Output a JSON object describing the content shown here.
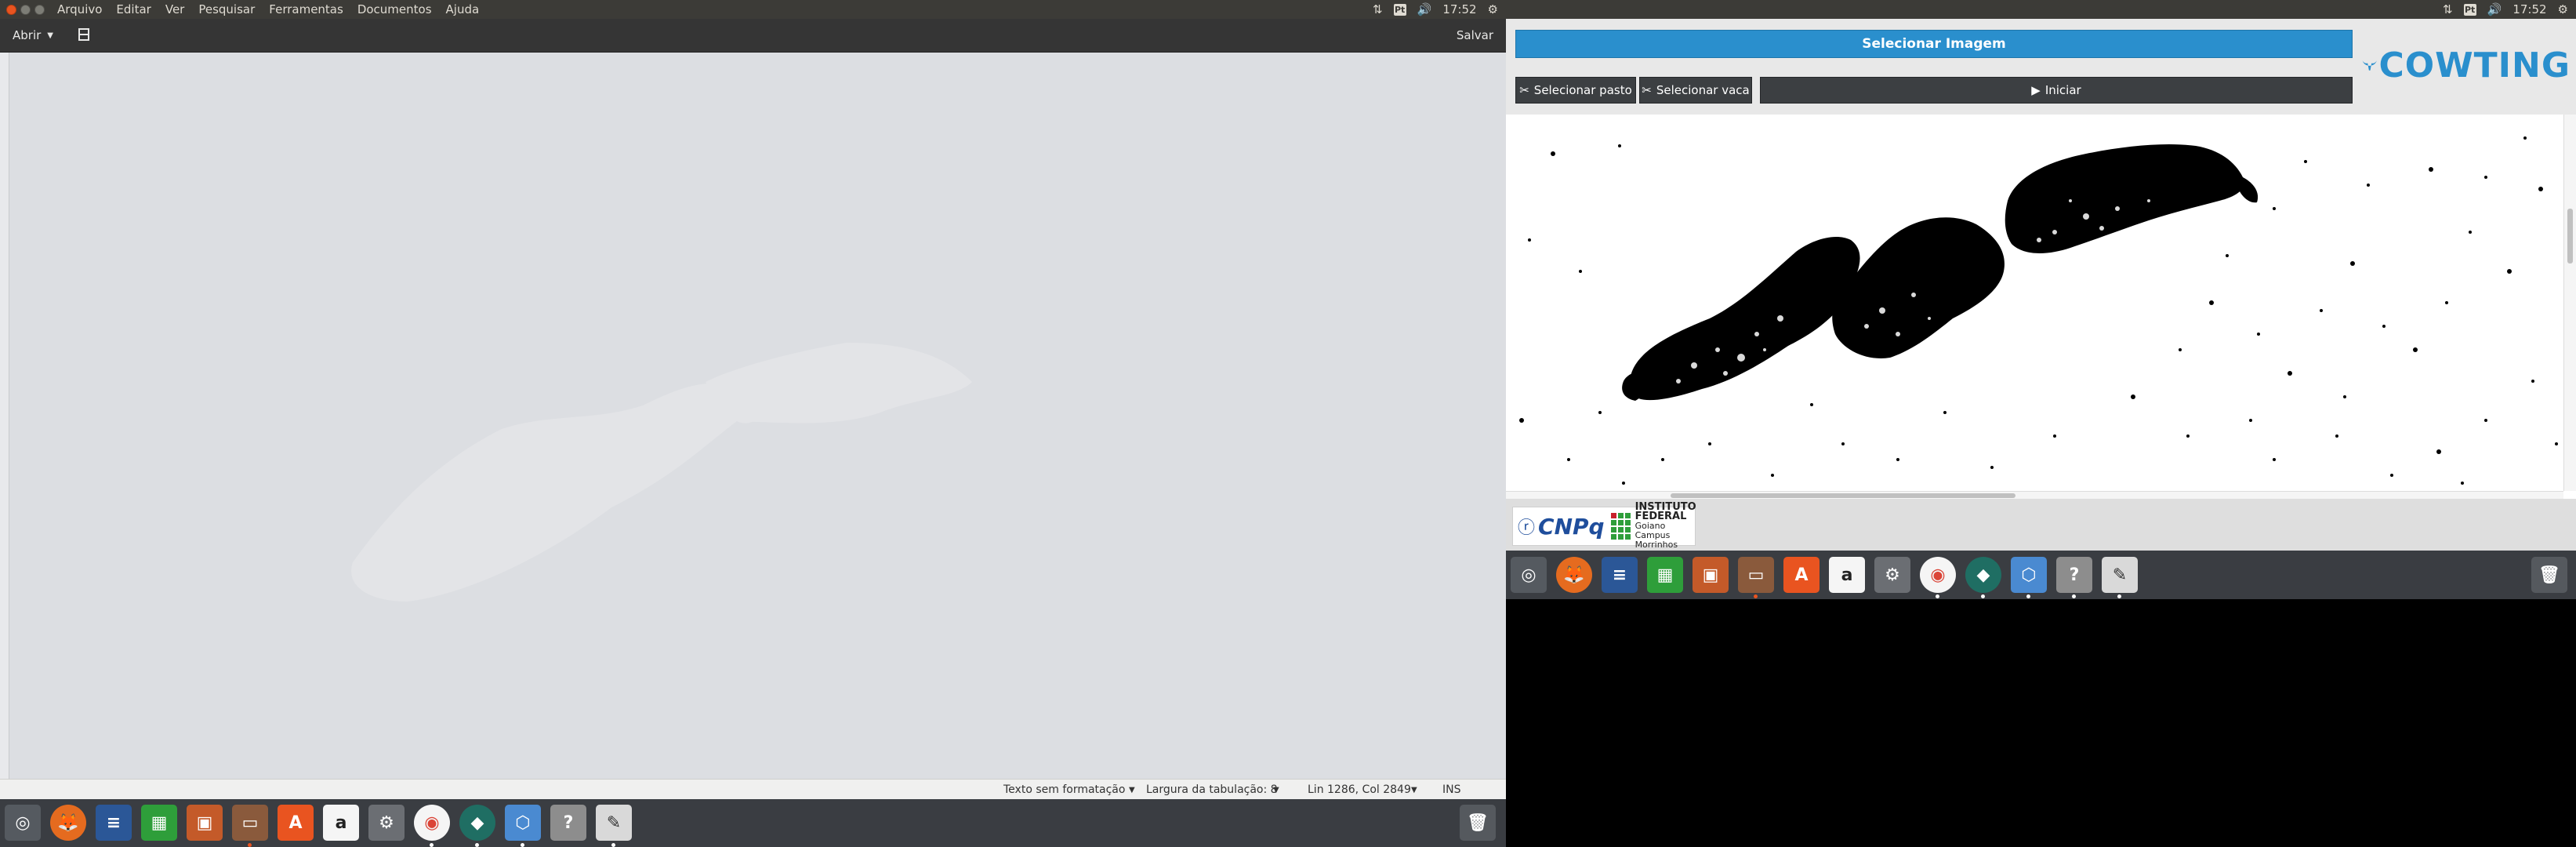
{
  "left_screen": {
    "topbar": {
      "menu": [
        "Arquivo",
        "Editar",
        "Ver",
        "Pesquisar",
        "Ferramentas",
        "Documentos",
        "Ajuda"
      ],
      "clock": "17:52",
      "keyboard": "Pt"
    },
    "gedit": {
      "open_label": "Abrir",
      "save_label": "Salvar"
    },
    "status": {
      "syntax": "Texto sem formatação",
      "tab_width": "Largura da tabulação: 8",
      "position": "Lin 1286, Col 2849",
      "mode": "INS"
    }
  },
  "right_screen": {
    "topbar": {
      "clock": "17:52",
      "keyboard": "Pt"
    },
    "app": {
      "select_image_label": "Selecionar Imagem",
      "select_pasture_label": "Selecionar pasto",
      "select_cow_label": "Selecionar vaca",
      "start_label": "Iniciar",
      "logo_text": "COWTING",
      "cnpq_text": "CNPq",
      "if_title": "INSTITUTO FEDERAL",
      "if_line2": "Goiano",
      "if_line3": "Campus Morrinhos"
    }
  },
  "dock_icons": [
    "ubuntu-launcher-icon",
    "firefox-icon",
    "writer-icon",
    "calc-icon",
    "impress-icon",
    "files-icon",
    "software-center-icon",
    "amazon-icon",
    "system-settings-icon",
    "chrome-icon",
    "ubuntu-make-icon",
    "virtualbox-icon",
    "help-icon",
    "text-editor-icon"
  ],
  "colors": {
    "accent_blue": "#2a8fcd",
    "ubuntu_orange": "#e95420",
    "topbar": "#3c3b37"
  }
}
